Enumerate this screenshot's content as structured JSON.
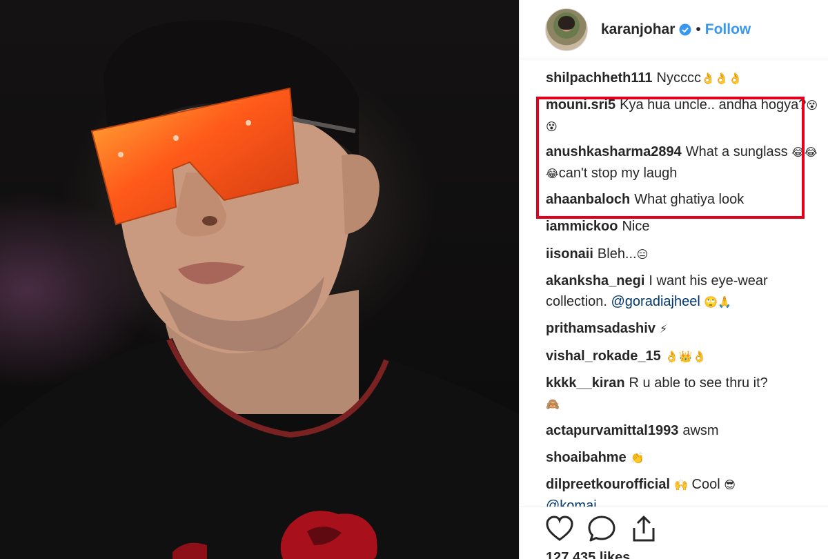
{
  "post": {
    "username": "karanjohar",
    "verified": true,
    "separator": "•",
    "follow_label": "Follow"
  },
  "comments": [
    {
      "user": "shilpachheth111",
      "text": "Nycccc",
      "emoji": "👌👌👌"
    },
    {
      "user": "mouni.sri5",
      "text": "Kya hua uncle.. andha hogya?",
      "emoji": "😵😵"
    },
    {
      "user": "anushkasharma2894",
      "text": "What a sunglass",
      "emoji": "😂😂😂",
      "text2": "can't stop my laugh"
    },
    {
      "user": "ahaanbaloch",
      "text": "What ghatiya look"
    },
    {
      "user": "iammickoo",
      "text": "Nice"
    },
    {
      "user": "iisonaii",
      "text": "Bleh...",
      "emoji": "😑"
    },
    {
      "user": "akanksha_negi",
      "text": "I want his eye-wear collection.",
      "mention": "@goradiajheel",
      "emoji": "🙄🙏"
    },
    {
      "user": "prithamsadashiv",
      "emoji": "⚡"
    },
    {
      "user": "vishal_rokade_15",
      "emoji": "👌👑👌"
    },
    {
      "user": "kkkk__kiran",
      "text": "R u able to see thru it?",
      "emoji": "🙈"
    },
    {
      "user": "actapurvamittal1993",
      "text": "awsm"
    },
    {
      "user": "shoaibahme",
      "emoji": "👏"
    },
    {
      "user": "dilpreetkourofficial",
      "emoji_pre": "🙌",
      "text": "Cool",
      "emoji": "😎"
    },
    {
      "user": "",
      "mention": "@komai"
    }
  ],
  "actions": {
    "like_icon": "heart-icon",
    "comment_icon": "comment-icon",
    "share_icon": "share-icon"
  },
  "likes_label": "127,435 likes",
  "colors": {
    "accent": "#3897f0",
    "highlight": "#e3001b",
    "text": "#262626",
    "lens": "#ff5a1a"
  }
}
